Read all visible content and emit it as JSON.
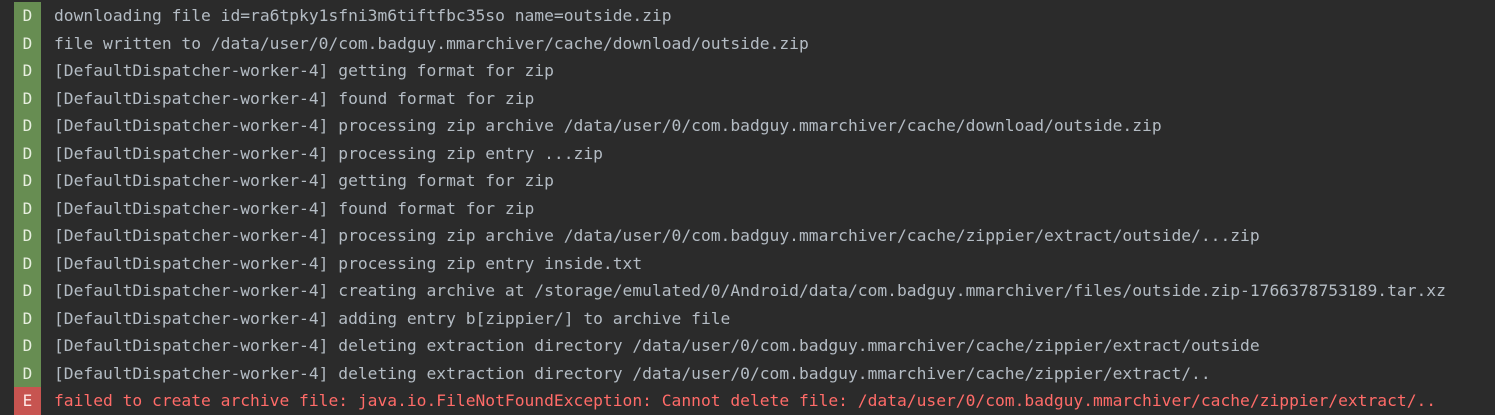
{
  "log": {
    "entries": [
      {
        "level": "D",
        "type": "debug",
        "message": "downloading file id=ra6tpky1sfni3m6tiftfbc35so name=outside.zip"
      },
      {
        "level": "D",
        "type": "debug",
        "message": "file written to /data/user/0/com.badguy.mmarchiver/cache/download/outside.zip"
      },
      {
        "level": "D",
        "type": "debug",
        "message": "[DefaultDispatcher-worker-4] getting format for zip"
      },
      {
        "level": "D",
        "type": "debug",
        "message": "[DefaultDispatcher-worker-4] found format for zip"
      },
      {
        "level": "D",
        "type": "debug",
        "message": "[DefaultDispatcher-worker-4] processing zip archive /data/user/0/com.badguy.mmarchiver/cache/download/outside.zip"
      },
      {
        "level": "D",
        "type": "debug",
        "message": "[DefaultDispatcher-worker-4] processing zip entry ...zip"
      },
      {
        "level": "D",
        "type": "debug",
        "message": "[DefaultDispatcher-worker-4] getting format for zip"
      },
      {
        "level": "D",
        "type": "debug",
        "message": "[DefaultDispatcher-worker-4] found format for zip"
      },
      {
        "level": "D",
        "type": "debug",
        "message": "[DefaultDispatcher-worker-4] processing zip archive /data/user/0/com.badguy.mmarchiver/cache/zippier/extract/outside/...zip"
      },
      {
        "level": "D",
        "type": "debug",
        "message": "[DefaultDispatcher-worker-4] processing zip entry inside.txt"
      },
      {
        "level": "D",
        "type": "debug",
        "message": "[DefaultDispatcher-worker-4] creating archive at /storage/emulated/0/Android/data/com.badguy.mmarchiver/files/outside.zip-1766378753189.tar.xz"
      },
      {
        "level": "D",
        "type": "debug",
        "message": "[DefaultDispatcher-worker-4] adding entry b[zippier/] to archive file"
      },
      {
        "level": "D",
        "type": "debug",
        "message": "[DefaultDispatcher-worker-4] deleting extraction directory /data/user/0/com.badguy.mmarchiver/cache/zippier/extract/outside"
      },
      {
        "level": "D",
        "type": "debug",
        "message": "[DefaultDispatcher-worker-4] deleting extraction directory /data/user/0/com.badguy.mmarchiver/cache/zippier/extract/.."
      },
      {
        "level": "E",
        "type": "error",
        "message": "failed to create archive file: java.io.FileNotFoundException: Cannot delete file: /data/user/0/com.badguy.mmarchiver/cache/zippier/extract/.."
      }
    ]
  },
  "colors": {
    "background": "#2b2b2b",
    "debug_badge": "#678d52",
    "error_badge": "#c75450",
    "debug_text": "#b4bcc4",
    "error_text": "#ff6b68"
  }
}
